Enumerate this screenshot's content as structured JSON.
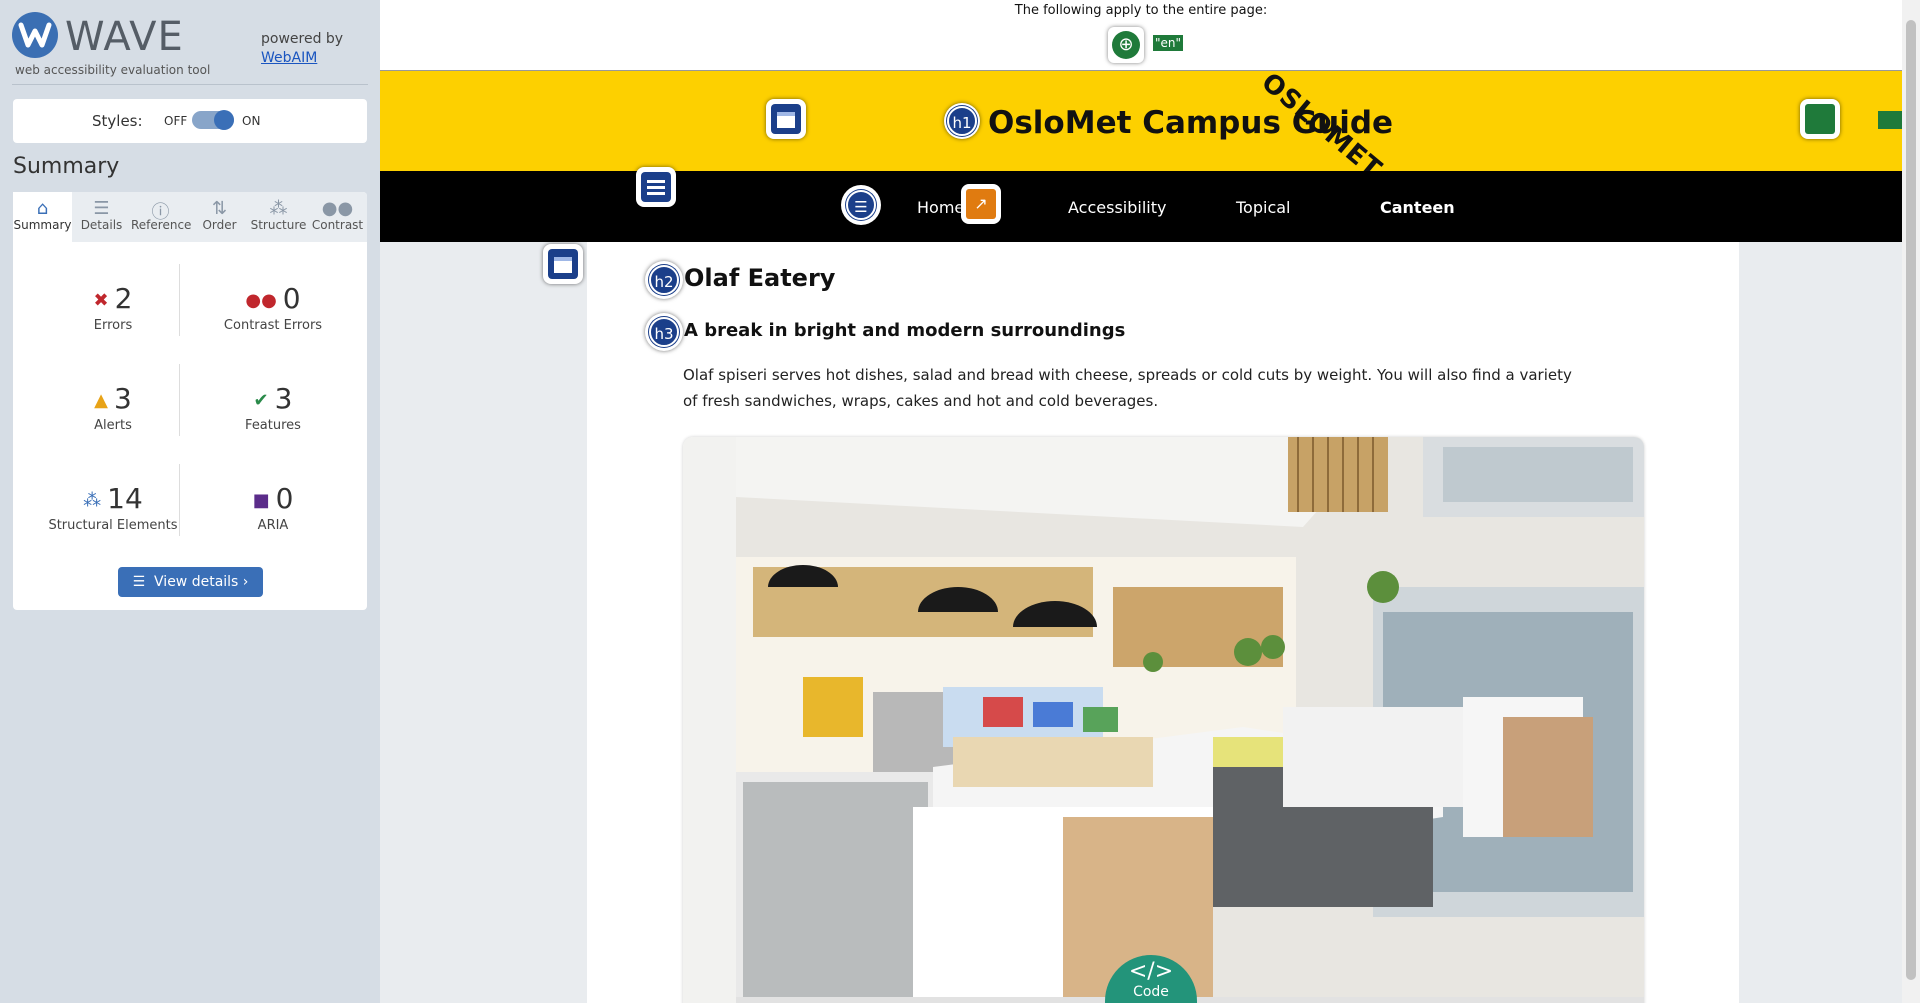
{
  "wave": {
    "title": "WAVE",
    "subtitle": "web accessibility evaluation tool",
    "powered_by": "powered by",
    "webaim_link": "WebAIM",
    "styles_label": "Styles:",
    "styles_off": "OFF",
    "styles_on": "ON",
    "styles_enabled": true,
    "summary_heading": "Summary",
    "tabs": [
      {
        "label": "Summary",
        "icon": "home-icon",
        "active": true
      },
      {
        "label": "Details",
        "icon": "list-icon",
        "active": false
      },
      {
        "label": "Reference",
        "icon": "info-icon",
        "active": false
      },
      {
        "label": "Order",
        "icon": "order-icon",
        "active": false
      },
      {
        "label": "Structure",
        "icon": "structure-icon",
        "active": false
      },
      {
        "label": "Contrast",
        "icon": "contrast-icon",
        "active": false
      }
    ],
    "stats": {
      "errors": {
        "count": "2",
        "label": "Errors",
        "color": "#c0272d"
      },
      "contrast_errors": {
        "count": "0",
        "label": "Contrast Errors",
        "color": "#c0272d"
      },
      "alerts": {
        "count": "3",
        "label": "Alerts",
        "color": "#e8a317"
      },
      "features": {
        "count": "3",
        "label": "Features",
        "color": "#2a8a4a"
      },
      "structural": {
        "count": "14",
        "label": "Structural Elements",
        "color": "#3a6fb7"
      },
      "aria": {
        "count": "0",
        "label": "ARIA",
        "color": "#5b2c8a"
      }
    },
    "view_details": "View details ›"
  },
  "page": {
    "notice": "The following apply to the entire page:",
    "lang_tag": "\"en\"",
    "site_title": "OsloMet Campus Guide",
    "logo_text": "OSLOMET",
    "h1_tag": "h1",
    "h2_tag": "h2",
    "h3_tag": "h3",
    "nav": [
      "Home",
      "Accessibility",
      "Topical",
      "Canteen"
    ],
    "nav_active": "Canteen",
    "heading": "Olaf Eatery",
    "subheading": "A break in bright and modern surroundings",
    "paragraph": "Olaf spiseri serves hot dishes, salad and bread with cheese, spreads or cold cuts by weight. You will also find a variety of fresh sandwiches, wraps, cakes and hot and cold beverages.",
    "code_label": "Code"
  },
  "colors": {
    "brand_yellow": "#fdd000",
    "nav_black": "#000000",
    "wave_blue": "#3a6fb7",
    "wave_icon_navy": "#1b3f8a"
  }
}
